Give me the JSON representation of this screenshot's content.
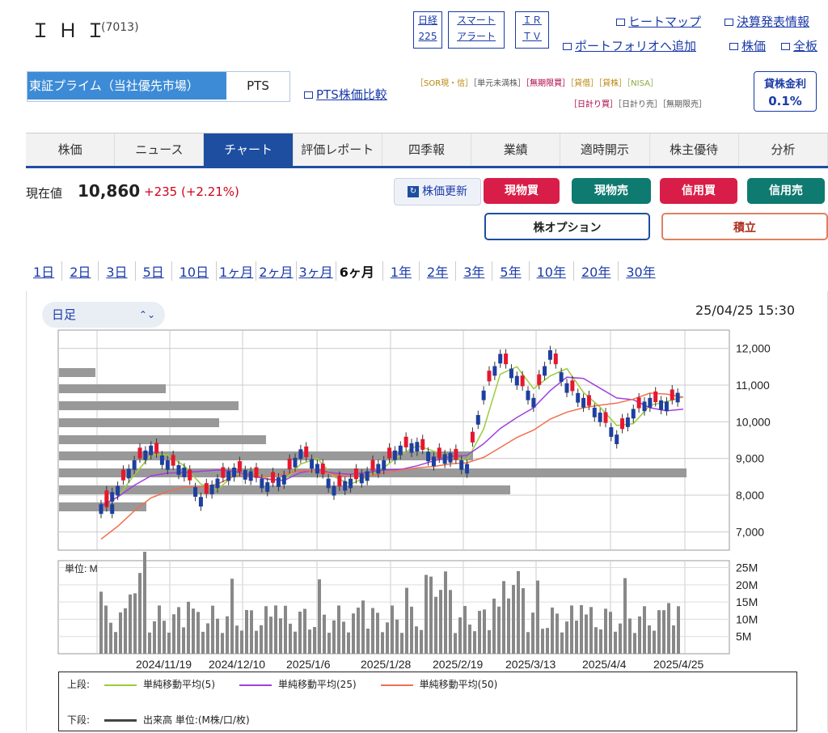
{
  "header": {
    "company": "ＩＨＩ",
    "code": "(7013)",
    "nikkei": [
      "日経",
      "225"
    ],
    "smart": [
      "スマート",
      "アラート"
    ],
    "irtv": [
      "ＩＲ",
      "ＴＶ"
    ],
    "links": {
      "heatmap": "ヒートマップ",
      "earnings": "決算発表情報",
      "portfolio": "ポートフォリオへ追加",
      "stock": "株価",
      "all": "全板"
    }
  },
  "market": {
    "primary": "東証プライム（当社優先市場）",
    "pts": "PTS",
    "pts_compare": "PTS株価比較",
    "badges": [
      "［SOR現・信］",
      "［単元未満株］",
      "［無期限買］",
      "［貸借］",
      "［貸株］",
      "［NISA］"
    ],
    "badges2": [
      "［日計り買］",
      "［日計り売］",
      "［無期限売］"
    ]
  },
  "lending": {
    "label": "貸株金利",
    "rate": "0.1%"
  },
  "tabs": [
    "株価",
    "ニュース",
    "チャート",
    "評価レポート",
    "四季報",
    "業績",
    "適時開示",
    "株主優待",
    "分析"
  ],
  "quote": {
    "label": "現在値",
    "price": "10,860",
    "change": "+235 (+2.21%)",
    "refresh": "株価更新"
  },
  "buttons": {
    "cash_buy": "現物買",
    "cash_sell": "現物売",
    "margin_buy": "信用買",
    "margin_sell": "信用売",
    "option": "株オプション",
    "accum": "積立"
  },
  "periods": [
    "1日",
    "2日",
    "3日",
    "5日",
    "10日",
    "1ヶ月",
    "2ヶ月",
    "3ヶ月",
    "6ヶ月",
    "1年",
    "2年",
    "3年",
    "5年",
    "10年",
    "20年",
    "30年"
  ],
  "chart": {
    "interval": "日足",
    "timestamp": "25/04/25 15:30"
  },
  "chart_data": {
    "type": "line",
    "price_axis": [
      "12,000",
      "11,000",
      "10,000",
      "9,000",
      "8,000",
      "7,000"
    ],
    "ylim": [
      6500,
      12500
    ],
    "x_labels": [
      "2024/11/19",
      "2024/12/10",
      "2025/1/6",
      "2025/1/28",
      "2025/2/19",
      "2025/3/13",
      "2025/4/4",
      "2025/4/25"
    ],
    "volume_unit": "単位: M",
    "volume_axis": [
      "25M",
      "20M",
      "15M",
      "10M",
      "5M"
    ],
    "close_approx": [
      7700,
      8200,
      8900,
      9300,
      8900,
      8700,
      7900,
      8400,
      8700,
      8600,
      8300,
      8500,
      9200,
      8800,
      8200,
      8400,
      8600,
      8900,
      9300,
      9400,
      9000,
      9100,
      8800,
      10800,
      11800,
      11200,
      10600,
      11900,
      11000,
      10600,
      10200,
      9600,
      10300,
      10600,
      10500,
      10860
    ],
    "series": [
      {
        "name": "単純移動平均(5)",
        "color": "#9ccc3a"
      },
      {
        "name": "単純移動平均(25)",
        "color": "#a040e0"
      },
      {
        "name": "単純移動平均(50)",
        "color": "#f07050"
      }
    ]
  },
  "legend": {
    "upper_label": "上段:",
    "lower_label": "下段:",
    "volume_name": "出来高 単位:(M株/口/枚)"
  }
}
